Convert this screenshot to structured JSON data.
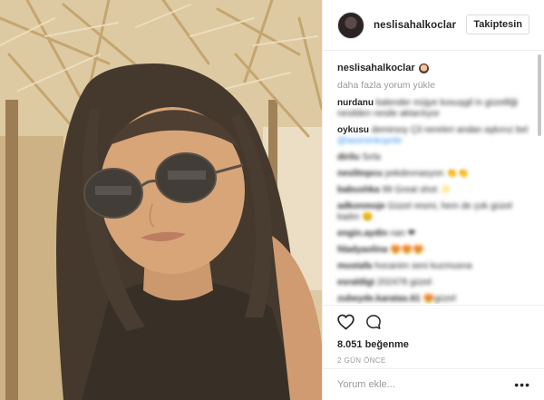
{
  "post": {
    "username": "neslisahalkoclar",
    "follow_label": "Takiptesin",
    "load_more": "daha fazla yorum yükle",
    "likes": "8.051 beğenme",
    "timestamp": "2 GÜN ÖNCE",
    "comment_placeholder": "Yorum ekle...",
    "more_options": "•••"
  },
  "comments": [
    {
      "user": "nurdanu",
      "text": "kalender müjye kosuşgil in güzelliği nesilden nesile aktarılıyor"
    },
    {
      "user": "oykusu",
      "text": "demirsoy Çil nereleri andan aşkınız bel",
      "link": "@tasiminkoprile"
    },
    {
      "user": "dirilu",
      "text": "Sırla"
    },
    {
      "user": "neslitopcu",
      "text": "pekdevnasyon",
      "emoji": "👏👏"
    },
    {
      "user": "babushka",
      "text": "99 Great shot ✨"
    },
    {
      "user": "adkonmoje",
      "text": "Güzel resmi, hem de çok güzel kadın",
      "emoji": "😊"
    },
    {
      "user": "engin.aydin",
      "text": "nan ❤"
    },
    {
      "user": "fdadyaolina",
      "text": "😍😍😍"
    },
    {
      "user": "mustafa",
      "text": "hocanim seni kucmusna"
    },
    {
      "user": "esraldigi",
      "text": "202478 güzel"
    },
    {
      "user": "zubeyde.karatas.61",
      "text": "😍güzel"
    }
  ],
  "icons": {
    "like": "heart-outline-icon",
    "comment": "speech-bubble-icon",
    "more": "ellipsis-icon"
  },
  "colors": {
    "text": "#262626",
    "muted": "#999999",
    "link": "#3897f0",
    "border": "#efefef"
  }
}
